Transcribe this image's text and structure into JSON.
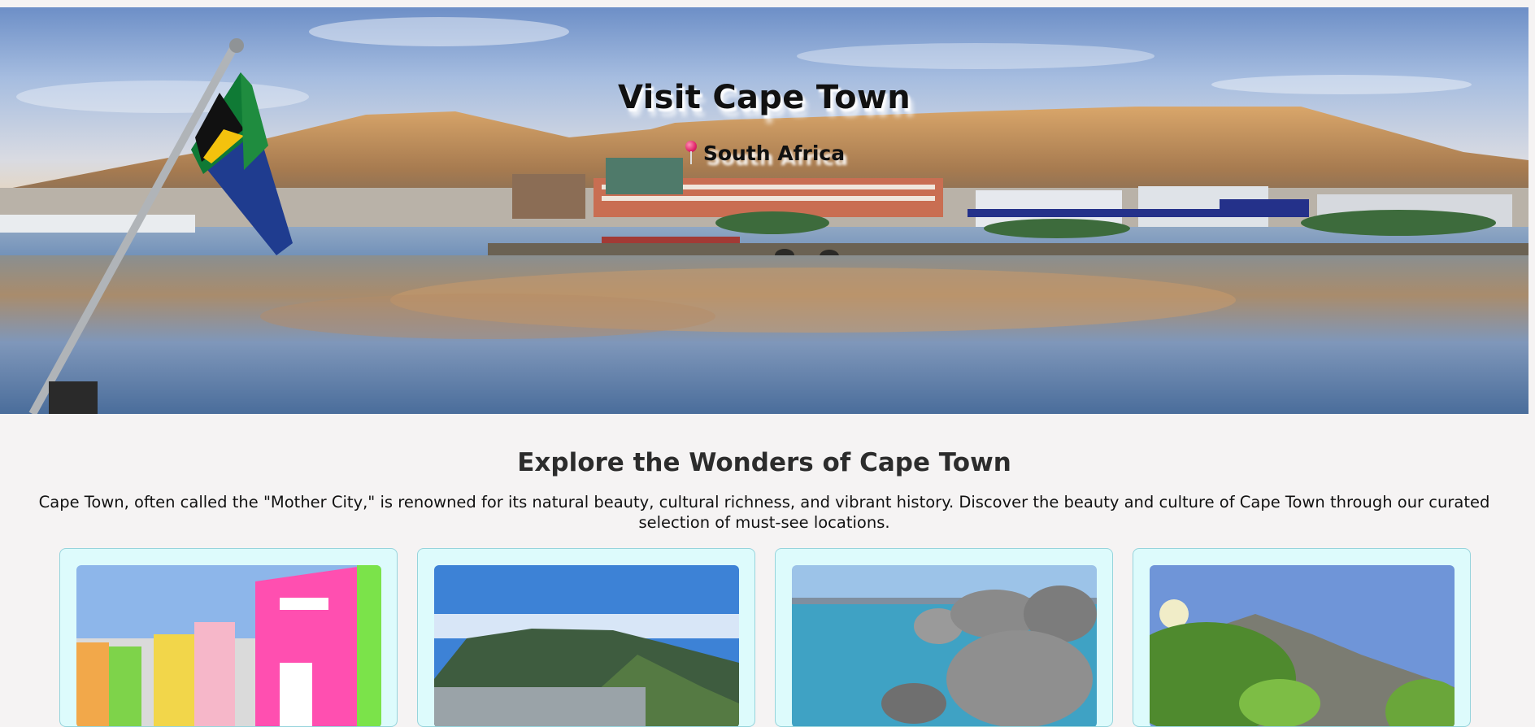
{
  "hero": {
    "title": "Visit Cape Town",
    "location": "South Africa",
    "pin_icon": "map-pin-icon",
    "background_image": "V&A Waterfront harbour with Table Mountain and South African flag"
  },
  "intro": {
    "heading": "Explore the Wonders of Cape Town",
    "text": "Cape Town, often called the \"Mother City,\" is renowned for its natural beauty, cultural richness, and vibrant history. Discover the beauty and culture of Cape Town through our curated selection of must-see locations."
  },
  "cards": [
    {
      "image": "Colorful houses of Bo-Kaap"
    },
    {
      "image": "Aerial view of Table Mountain and city"
    },
    {
      "image": "Boulders Beach rocks and sea"
    },
    {
      "image": "Mountain trail with green trees"
    }
  ],
  "colors": {
    "page_background": "#f5f3f3",
    "card_background": "#ddfbfc",
    "card_border": "#96d4dc",
    "pin": "#e0246a"
  }
}
